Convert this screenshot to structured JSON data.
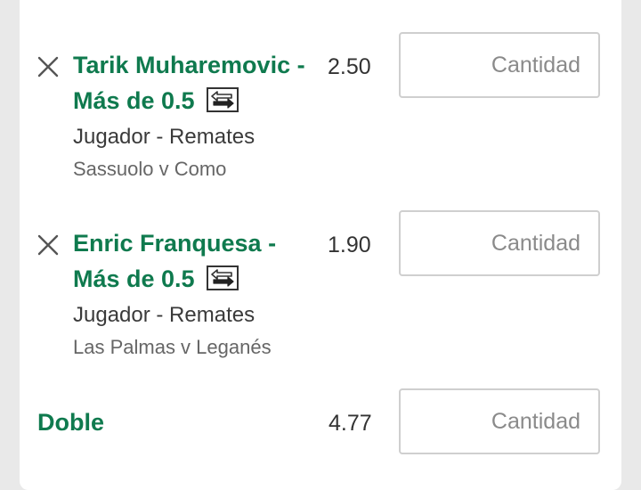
{
  "bets": [
    {
      "title": "Tarik Muharemovic - Más de 0.5",
      "market": "Jugador - Remates",
      "event": "Sassuolo v Como",
      "odds": "2.50",
      "stake_placeholder": "Cantidad",
      "stake_value": ""
    },
    {
      "title": "Enric Franquesa - Más de 0.5",
      "market": "Jugador - Remates",
      "event": "Las Palmas v Leganés",
      "odds": "1.90",
      "stake_placeholder": "Cantidad",
      "stake_value": ""
    }
  ],
  "combo": {
    "label": "Doble",
    "odds": "4.77",
    "stake_placeholder": "Cantidad",
    "stake_value": ""
  },
  "colors": {
    "accent_green": "#0f7a4e",
    "card_background": "#ffffff",
    "page_background": "#e9e9e9"
  },
  "icons": {
    "remove": "close-icon",
    "swap": "swap-arrows-icon"
  }
}
